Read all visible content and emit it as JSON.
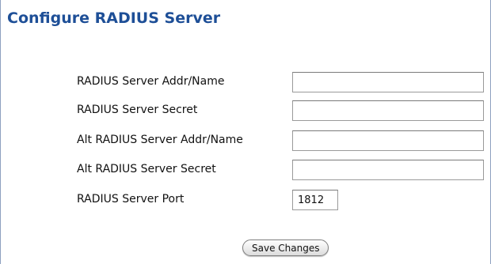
{
  "page": {
    "title": "Configure RADIUS Server"
  },
  "fields": {
    "server_addr": {
      "label": "RADIUS Server Addr/Name",
      "value": ""
    },
    "server_secret": {
      "label": "RADIUS Server Secret",
      "value": ""
    },
    "alt_server_addr": {
      "label": "Alt RADIUS Server Addr/Name",
      "value": ""
    },
    "alt_server_secret": {
      "label": "Alt RADIUS Server Secret",
      "value": ""
    },
    "server_port": {
      "label": "RADIUS Server Port",
      "value": "1812"
    }
  },
  "actions": {
    "save_label": "Save Changes"
  },
  "colors": {
    "title": "#1e4f97",
    "panel_border": "#8ea0bf"
  }
}
